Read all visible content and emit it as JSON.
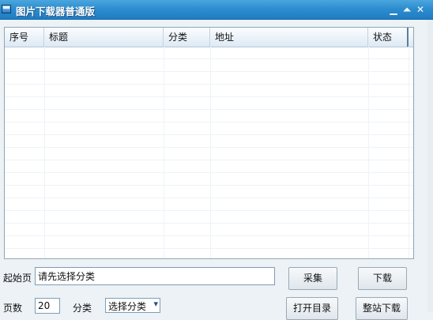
{
  "window": {
    "title": "图片下载器普通版"
  },
  "window_controls": {
    "min": "▁",
    "max": "⏶",
    "close": "✕"
  },
  "table": {
    "columns": [
      "序号",
      "标题",
      "分类",
      "地址",
      "状态"
    ],
    "rows": []
  },
  "form": {
    "start_page_label": "起始页",
    "start_page_value": "请先选择分类",
    "pages_label": "页数",
    "pages_value": "20",
    "category_label": "分类",
    "category_selected": "选择分类",
    "category_arrow": "▾"
  },
  "buttons": {
    "collect": "采集",
    "download": "下载",
    "open_dir": "打开目录",
    "site_download": "整站下载"
  }
}
